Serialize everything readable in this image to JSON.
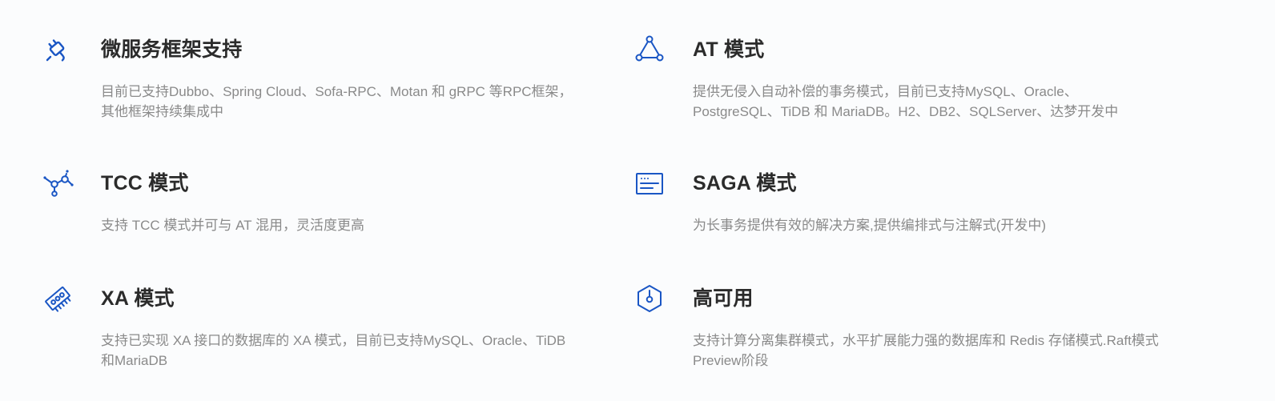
{
  "accent_color": "#1a56c4",
  "features": [
    {
      "icon": "plug-icon",
      "title": "微服务框架支持",
      "description": "目前已支持Dubbo、Spring Cloud、Sofa-RPC、Motan 和 gRPC 等RPC框架，其他框架持续集成中"
    },
    {
      "icon": "triangle-nodes-icon",
      "title": "AT 模式",
      "description": "提供无侵入自动补偿的事务模式，目前已支持MySQL、Oracle、PostgreSQL、TiDB 和 MariaDB。H2、DB2、SQLServer、达梦开发中"
    },
    {
      "icon": "molecule-icon",
      "title": "TCC 模式",
      "description": "支持 TCC 模式并可与 AT 混用，灵活度更高"
    },
    {
      "icon": "terminal-window-icon",
      "title": "SAGA 模式",
      "description": "为长事务提供有效的解决方案,提供编排式与注解式(开发中)"
    },
    {
      "icon": "memory-chip-icon",
      "title": "XA 模式",
      "description": "支持已实现 XA 接口的数据库的 XA 模式，目前已支持MySQL、Oracle、TiDB和MariaDB"
    },
    {
      "icon": "hexagon-node-icon",
      "title": "高可用",
      "description": "支持计算分离集群模式，水平扩展能力强的数据库和 Redis 存储模式.Raft模式Preview阶段"
    }
  ]
}
